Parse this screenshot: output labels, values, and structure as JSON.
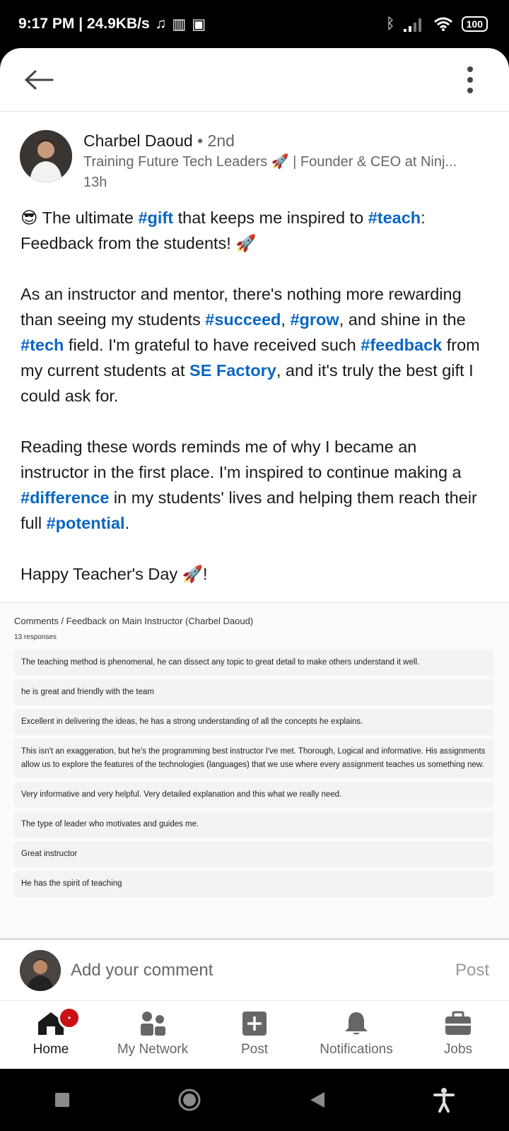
{
  "status_bar": {
    "time_speed": "9:17 PM | 24.9KB/s",
    "battery": "100"
  },
  "post": {
    "author_name": "Charbel Daoud",
    "degree": " • 2nd",
    "headline": "Training Future Tech Leaders 🚀 | Founder & CEO at Ninj...",
    "time": "13h",
    "p1": {
      "a": "😎 The ultimate ",
      "tag1": "#gift",
      "b": " that keeps me inspired to ",
      "tag2": "#teach",
      "c": ": Feedback from the students! 🚀"
    },
    "p2": {
      "a": "As an instructor and mentor, there's nothing more rewarding than seeing my students ",
      "tag1": "#succeed",
      "b": ", ",
      "tag2": "#grow",
      "c": ", and shine in the ",
      "tag3": "#tech",
      "d": " field. I'm grateful to have received such ",
      "tag4": "#feedback",
      "e": " from my current students at ",
      "link": "SE Factory",
      "f": ", and it's truly the best gift I could ask for."
    },
    "p3": {
      "a": "Reading these words reminds me of why I became an instructor in the first place. I'm inspired to continue making a ",
      "tag1": "#difference",
      "b": " in my students' lives and helping them reach their full ",
      "tag2": "#potential",
      "c": "."
    },
    "p4": "Happy Teacher's Day 🚀!"
  },
  "feedback": {
    "title": "Comments / Feedback on Main Instructor (Charbel Daoud)",
    "count": "13 responses",
    "items": [
      "The teaching method is phenomenal, he can dissect any topic to great detail to make others understand it well.",
      "he is great and friendly with the team",
      "Excellent in delivering the ideas, he has a strong understanding of all the concepts he explains.",
      "This isn't an exaggeration, but he's the programming best instructor I've met. Thorough, Logical and informative. His assignments allow us to explore the features of the technologies (languages) that we use where every assignment teaches us something new.",
      "Very informative and very helpful. Very detailed explanation and this what we really need.",
      "The type of leader who motivates and guides me.",
      "Great instructor",
      "He has the spirit of teaching"
    ]
  },
  "comment": {
    "placeholder": "Add your comment",
    "post_label": "Post"
  },
  "nav": {
    "home": "Home",
    "network": "My Network",
    "post": "Post",
    "notifications": "Notifications",
    "jobs": "Jobs"
  },
  "colors": {
    "accent": "#0a66c2",
    "badge": "#cc1016"
  }
}
